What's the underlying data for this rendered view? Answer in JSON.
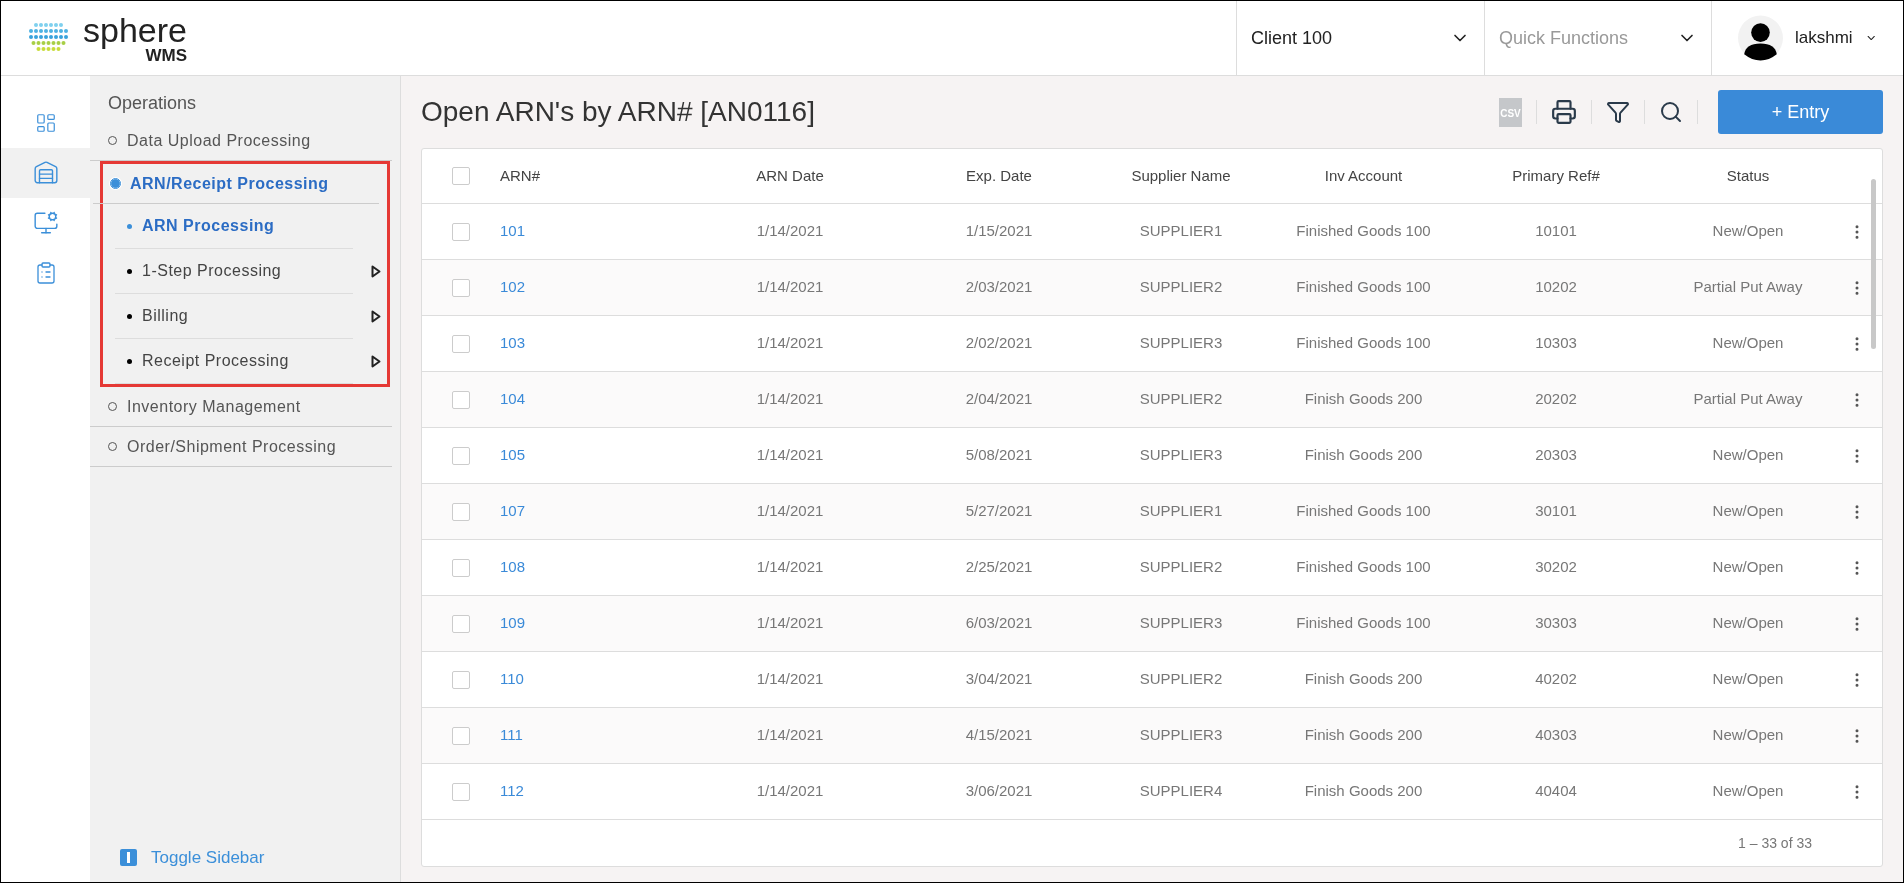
{
  "header": {
    "logo_name": "sphere",
    "logo_sub": "WMS",
    "client_select": {
      "value": "Client 100"
    },
    "quick_functions": {
      "placeholder": "Quick Functions"
    },
    "user": {
      "name": "lakshmi"
    }
  },
  "rail": [
    {
      "kind": "dashboard",
      "selected": false
    },
    {
      "kind": "warehouse",
      "selected": true
    },
    {
      "kind": "report",
      "selected": false
    },
    {
      "kind": "clipboard",
      "selected": false
    }
  ],
  "sidebar": {
    "heading": "Operations",
    "items": [
      {
        "label": "Data Upload Processing",
        "selected": false,
        "highlighted": false
      },
      {
        "label": "ARN/Receipt Processing",
        "selected": true,
        "highlighted": true,
        "children": [
          {
            "label": "ARN Processing",
            "selected": true,
            "has_submenu": false
          },
          {
            "label": "1-Step Processing",
            "selected": false,
            "has_submenu": true
          },
          {
            "label": "Billing",
            "selected": false,
            "has_submenu": true
          },
          {
            "label": "Receipt Processing",
            "selected": false,
            "has_submenu": true
          }
        ]
      },
      {
        "label": "Inventory Management",
        "selected": false,
        "highlighted": false
      },
      {
        "label": "Order/Shipment Processing",
        "selected": false,
        "highlighted": false
      }
    ],
    "toggle": "Toggle Sidebar"
  },
  "page": {
    "title": "Open ARN's by ARN# [AN0116]",
    "csv_label": "CSV",
    "entry_button": "+ Entry"
  },
  "table": {
    "select_all_checked": false,
    "columns": [
      "ARN#",
      "ARN Date",
      "Exp. Date",
      "Supplier Name",
      "Inv Account",
      "Primary Ref#",
      "Status"
    ],
    "rows": [
      {
        "checked": false,
        "cells": [
          "101",
          "1/14/2021",
          "1/15/2021",
          "SUPPLIER1",
          "Finished Goods 100",
          "10101",
          "New/Open"
        ]
      },
      {
        "checked": false,
        "cells": [
          "102",
          "1/14/2021",
          "2/03/2021",
          "SUPPLIER2",
          "Finished Goods 100",
          "10202",
          "Partial Put Away"
        ]
      },
      {
        "checked": false,
        "cells": [
          "103",
          "1/14/2021",
          "2/02/2021",
          "SUPPLIER3",
          "Finished Goods 100",
          "10303",
          "New/Open"
        ]
      },
      {
        "checked": false,
        "cells": [
          "104",
          "1/14/2021",
          "2/04/2021",
          "SUPPLIER2",
          "Finish Goods 200",
          "20202",
          "Partial Put Away"
        ]
      },
      {
        "checked": false,
        "cells": [
          "105",
          "1/14/2021",
          "5/08/2021",
          "SUPPLIER3",
          "Finish Goods 200",
          "20303",
          "New/Open"
        ]
      },
      {
        "checked": false,
        "cells": [
          "107",
          "1/14/2021",
          "5/27/2021",
          "SUPPLIER1",
          "Finished Goods 100",
          "30101",
          "New/Open"
        ]
      },
      {
        "checked": false,
        "cells": [
          "108",
          "1/14/2021",
          "2/25/2021",
          "SUPPLIER2",
          "Finished Goods 100",
          "30202",
          "New/Open"
        ]
      },
      {
        "checked": false,
        "cells": [
          "109",
          "1/14/2021",
          "6/03/2021",
          "SUPPLIER3",
          "Finished Goods 100",
          "30303",
          "New/Open"
        ]
      },
      {
        "checked": false,
        "cells": [
          "110",
          "1/14/2021",
          "3/04/2021",
          "SUPPLIER2",
          "Finish Goods 200",
          "40202",
          "New/Open"
        ]
      },
      {
        "checked": false,
        "cells": [
          "111",
          "1/14/2021",
          "4/15/2021",
          "SUPPLIER3",
          "Finish Goods 200",
          "40303",
          "New/Open"
        ]
      },
      {
        "checked": false,
        "cells": [
          "112",
          "1/14/2021",
          "3/06/2021",
          "SUPPLIER4",
          "Finish Goods 200",
          "40404",
          "New/Open"
        ]
      }
    ],
    "pagination": "1 – 33 of 33"
  }
}
